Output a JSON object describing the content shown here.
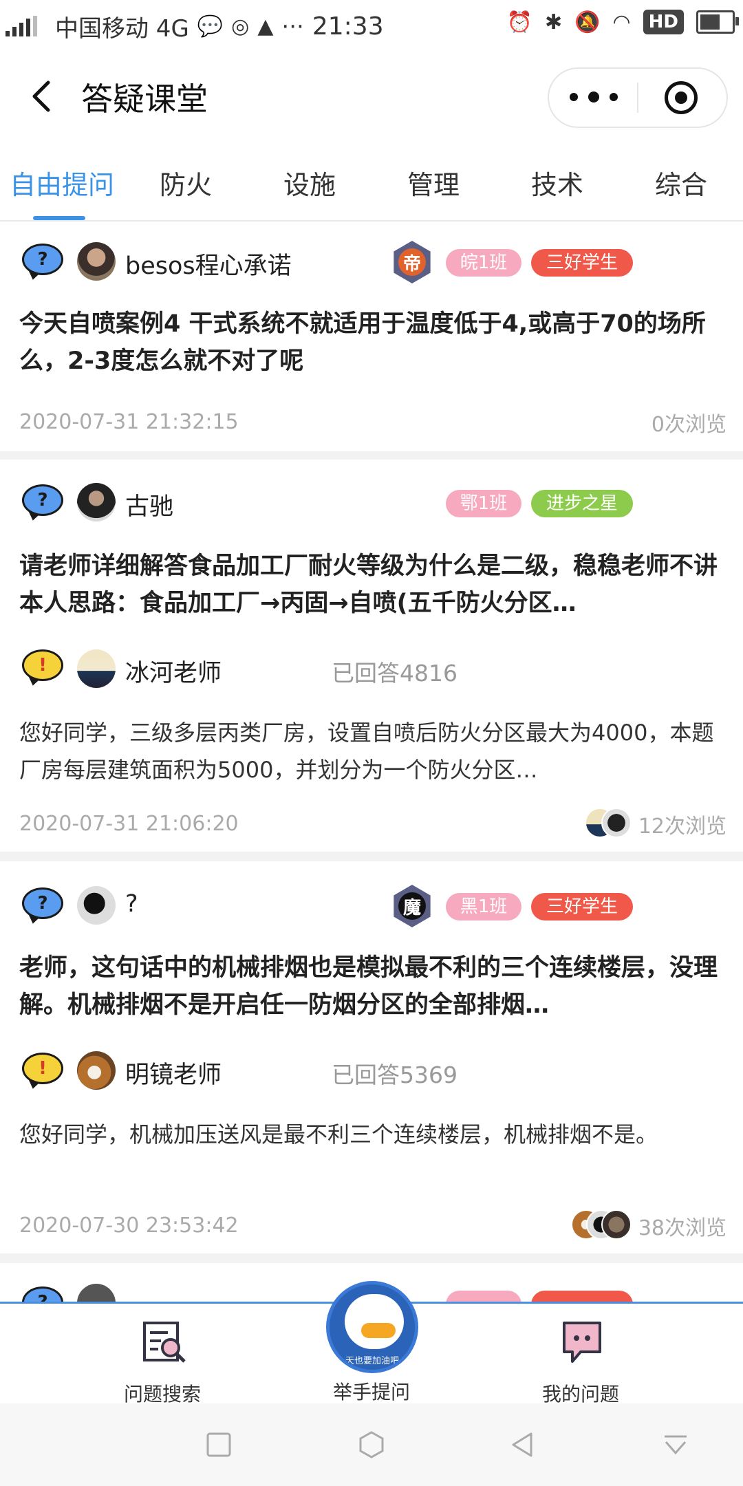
{
  "status_bar": {
    "carrier": "中国移动 4G",
    "time": "21:33",
    "hd": "HD",
    "signal_label": "4G"
  },
  "title_bar": {
    "title": "答疑课堂"
  },
  "tabs": [
    {
      "label": "自由提问",
      "active": true
    },
    {
      "label": "防火",
      "active": false
    },
    {
      "label": "设施",
      "active": false
    },
    {
      "label": "管理",
      "active": false
    },
    {
      "label": "技术",
      "active": false
    },
    {
      "label": "综合",
      "active": false
    }
  ],
  "cards": [
    {
      "asker": "besos程心承诺",
      "medal": "帝",
      "class_tag": "皖1班",
      "honor_tag": "三好学生",
      "question": "今天自喷案例4 干式系统不就适用于温度低于4,或高于70的场所么，2-3度怎么就不对了呢",
      "date": "2020-07-31 21:32:15",
      "views": "0次浏览"
    },
    {
      "asker": "古驰",
      "class_tag": "鄂1班",
      "honor_tag": "进步之星",
      "question": "请老师详细解答食品加工厂耐火等级为什么是二级，稳稳老师不讲 本人思路：食品加工厂→丙固→自喷(五千防火分区…",
      "teacher": "冰河老师",
      "answered": "已回答4816",
      "answer": "您好同学，三级多层丙类厂房，设置自喷后防火分区最大为4000，本题厂房每层建筑面积为5000，并划分为一个防火分区…",
      "date": "2020-07-31 21:06:20",
      "views": "12次浏览"
    },
    {
      "asker": "?",
      "medal": "魔",
      "class_tag": "黑1班",
      "honor_tag": "三好学生",
      "question": "老师，这句话中的机械排烟也是模拟最不利的三个连续楼层，没理解。机械排烟不是开启任一防烟分区的全部排烟…",
      "teacher": "明镜老师",
      "answered": "已回答5369",
      "answer": "您好同学，机械加压送风是最不利三个连续楼层，机械排烟不是。",
      "date": "2020-07-30 23:53:42",
      "views": "38次浏览"
    }
  ],
  "bottom_nav": {
    "search_label": "问题搜索",
    "ask_label": "举手提问",
    "ask_avatar_caption": "天也要加油吧",
    "mine_label": "我的问题"
  },
  "colors": {
    "accent": "#3b93e8",
    "tag_pink": "#f7a9bf",
    "tag_red": "#f0584a",
    "tag_green": "#8ccb4b"
  }
}
